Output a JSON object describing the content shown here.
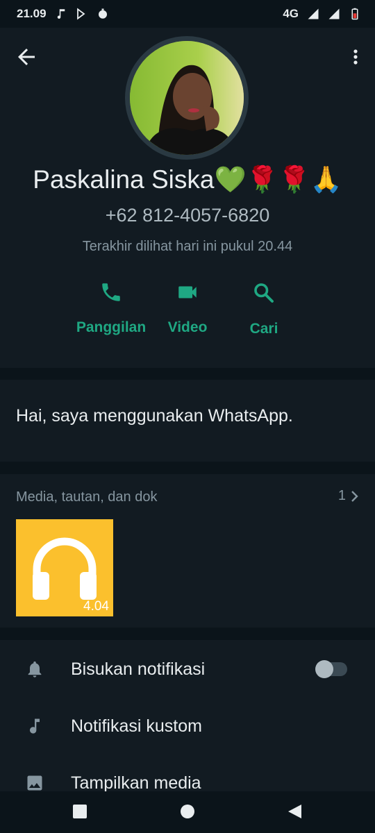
{
  "status_bar": {
    "time": "21.09",
    "network": "4G",
    "left_icons": [
      "music-note-icon",
      "play-store-icon",
      "timer-icon"
    ],
    "right_icons": [
      "signal-icon",
      "signal-icon-2",
      "battery-low-icon"
    ]
  },
  "header": {
    "back_icon": "arrow-left-icon",
    "menu_icon": "more-vert-icon",
    "contact_name": "Paskalina Siska💚🌹🌹🙏",
    "phone": "+62 812-4057-6820",
    "last_seen": "Terakhir dilihat hari ini pukul 20.44",
    "actions": [
      {
        "icon": "phone-icon",
        "label": "Panggilan"
      },
      {
        "icon": "video-camera-icon",
        "label": "Video"
      },
      {
        "icon": "search-icon",
        "label": "Cari"
      }
    ],
    "accent_color": "#1fa883"
  },
  "about": {
    "text": "Hai, saya menggunakan WhatsApp."
  },
  "media": {
    "title": "Media, tautan, dan dok",
    "count": "1",
    "items": [
      {
        "type": "audio",
        "icon": "headphones-icon",
        "duration": "4.04",
        "color": "#fbc02d"
      }
    ]
  },
  "settings": {
    "items": [
      {
        "icon": "bell-icon",
        "label": "Bisukan notifikasi",
        "toggle": false
      },
      {
        "icon": "music-note-icon",
        "label": "Notifikasi kustom"
      },
      {
        "icon": "image-icon",
        "label": "Tampilkan media"
      }
    ]
  },
  "nav_bar": {
    "buttons": [
      "recents-square-icon",
      "home-circle-icon",
      "back-triangle-icon"
    ]
  }
}
